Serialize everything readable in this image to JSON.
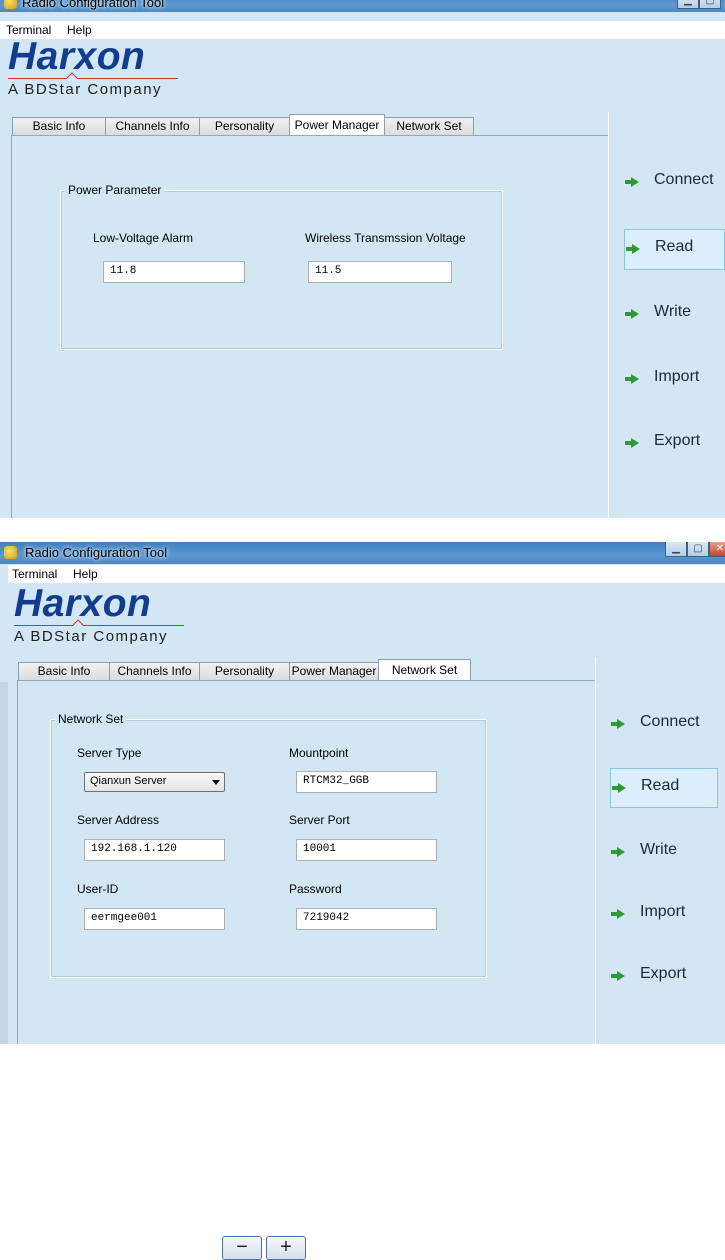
{
  "screenshot1": {
    "window_title": "Radio Configuration Tool",
    "menu": [
      "Terminal",
      "Help"
    ],
    "brand": {
      "logo": "Harxon",
      "tagline": "A BDStar Company"
    },
    "tabs": [
      "Basic Info",
      "Channels Info",
      "Personality",
      "Power Manager",
      "Network Set"
    ],
    "active_tab": "Power Manager",
    "group_title": "Power Parameter",
    "fields": {
      "low_voltage_label": "Low-Voltage Alarm",
      "low_voltage_value": "11.8",
      "tx_voltage_label": "Wireless Transmssion Voltage",
      "tx_voltage_value": "11.5"
    },
    "actions": [
      "Connect",
      "Read",
      "Write",
      "Import",
      "Export"
    ],
    "selected_action": "Read"
  },
  "screenshot2": {
    "window_title": "Radio Configuration Tool",
    "menu": [
      "Terminal",
      "Help"
    ],
    "brand": {
      "logo": "Harxon",
      "tagline": "A BDStar Company"
    },
    "tabs": [
      "Basic Info",
      "Channels Info",
      "Personality",
      "Power Manager",
      "Network Set"
    ],
    "active_tab": "Network Set",
    "group_title": "Network Set",
    "fields": {
      "server_type_label": "Server Type",
      "server_type_value": "Qianxun Server",
      "mountpoint_label": "Mountpoint",
      "mountpoint_value": "RTCM32_GGB",
      "server_address_label": "Server Address",
      "server_address_value": "192.168.1.120",
      "server_port_label": "Server Port",
      "server_port_value": "10001",
      "user_id_label": "User-ID",
      "user_id_value": "eermgee001",
      "password_label": "Password",
      "password_value": "7219042"
    },
    "actions": [
      "Connect",
      "Read",
      "Write",
      "Import",
      "Export"
    ],
    "selected_action": "Read"
  },
  "zoom_controls": {
    "minus": "−",
    "plus": "+"
  },
  "colors": {
    "window_bg": "#d3e6f4",
    "accent_arrow": "#2f9a35",
    "logo": "#123d8e",
    "logo_line": "#c0392b"
  }
}
